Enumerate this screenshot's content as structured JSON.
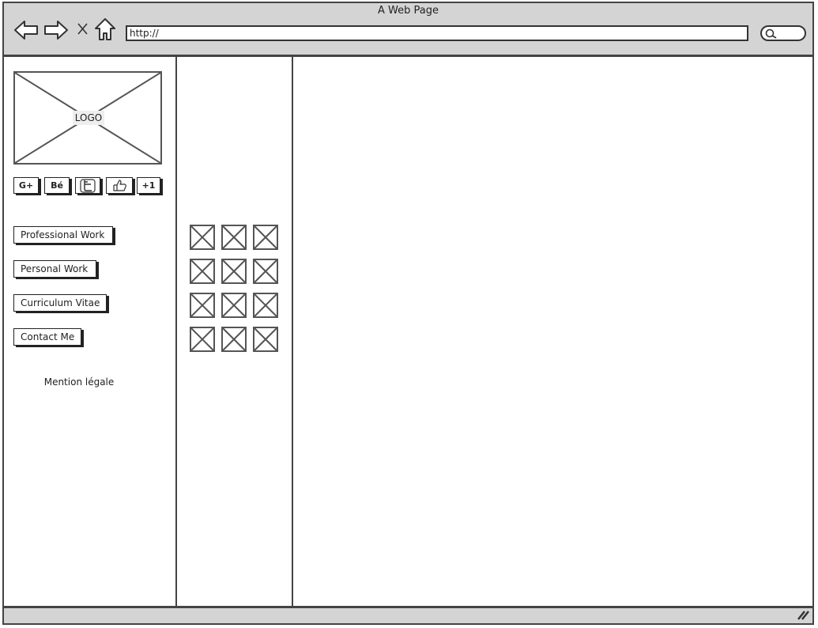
{
  "window": {
    "title": "A Web Page"
  },
  "browser": {
    "url": "http://",
    "icons": [
      "back-arrow-icon",
      "forward-arrow-icon",
      "close-icon",
      "home-icon",
      "search-icon"
    ]
  },
  "sidebar": {
    "logo_label": "LOGO",
    "social": [
      {
        "label": "G+",
        "icon": "google-plus-icon"
      },
      {
        "label": "Bé",
        "icon": "behance-icon"
      },
      {
        "label": "",
        "icon": "twitter-icon"
      },
      {
        "label": "",
        "icon": "like-thumb-icon"
      },
      {
        "label": "+1",
        "icon": "plus-one-icon"
      }
    ],
    "menu": [
      {
        "label": "Professional Work"
      },
      {
        "label": "Personal Work"
      },
      {
        "label": "Curriculum Vitae"
      },
      {
        "label": "Contact Me"
      }
    ],
    "legal": "Mention légale"
  },
  "gallery": {
    "rows": 4,
    "columns": 3,
    "thumbnail_icon": "image-placeholder-icon"
  },
  "colors": {
    "chrome": "#d4d4d4",
    "border": "#444444",
    "background": "#ffffff"
  }
}
